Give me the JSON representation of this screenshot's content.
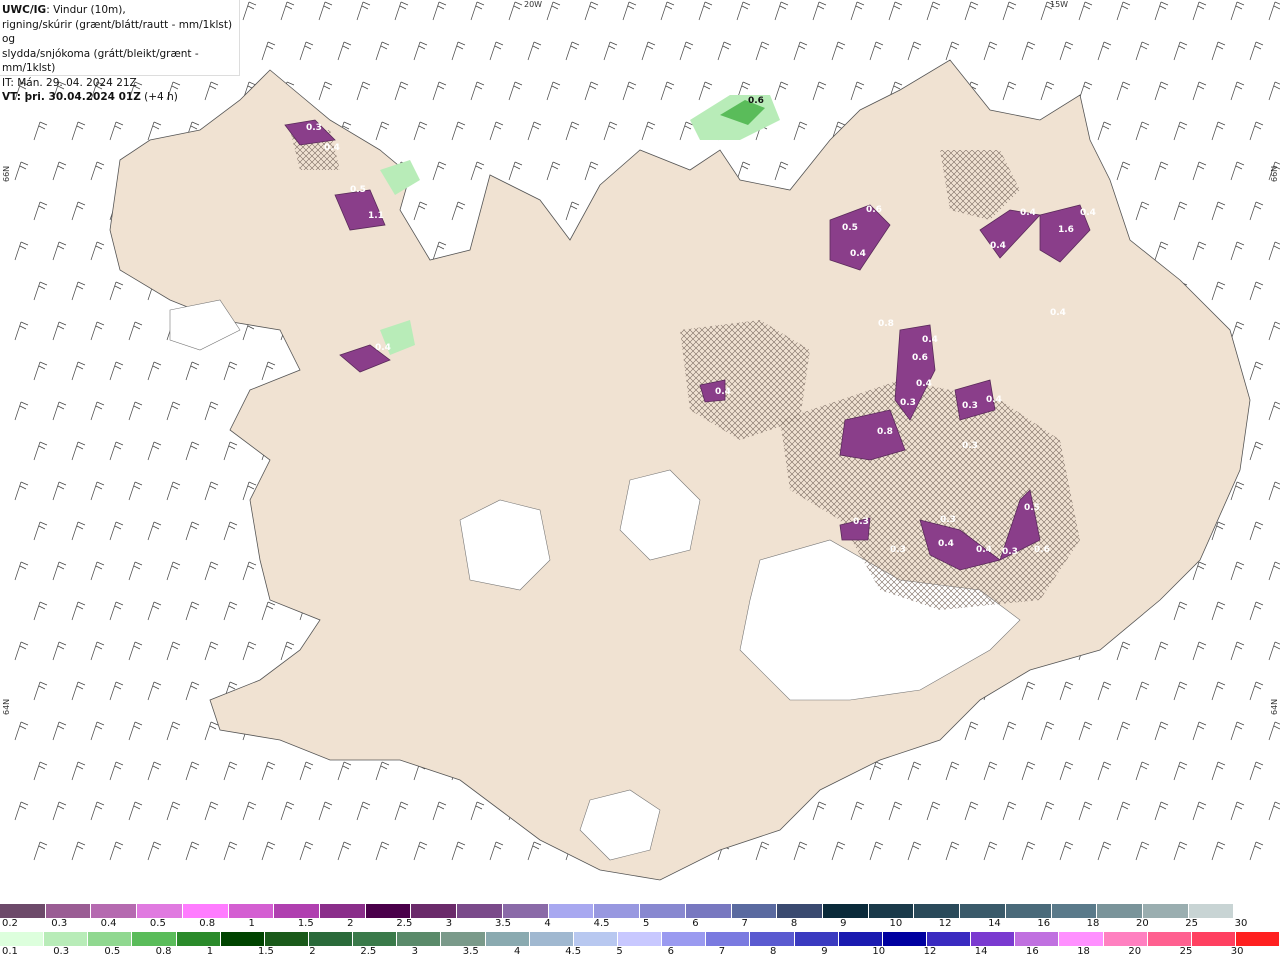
{
  "header": {
    "product": "UWC/IG",
    "description_1": ": Vindur (10m),",
    "description_2": "rigning/skúrir (grænt/blátt/rautt - mm/1klst) og",
    "description_3": "slydda/snjókoma (grátt/bleikt/grænt - mm/1klst)",
    "init_time": "IT: Mán. 29. 04. 2024 21Z",
    "valid_time_label": "VT: þri. 30.04.2024 01Z",
    "valid_offset": " (+4 h)"
  },
  "graticule": {
    "lon_left": "20W",
    "lon_right": "15W",
    "lat_top_left": "66N",
    "lat_top_right": "66N",
    "lat_bottom_left": "64N",
    "lat_bottom_right": "64N"
  },
  "precip_labels": [
    "0.3",
    "0.4",
    "0.5",
    "1.1",
    "0.4",
    "0.6",
    "0.6",
    "0.5",
    "0.4",
    "0.8",
    "0.4",
    "0.6",
    "0.4",
    "1.6",
    "0.4",
    "0.4",
    "0.4",
    "0.4",
    "0.3",
    "0.3",
    "0.4",
    "0.8",
    "0.3",
    "0.3",
    "0.3",
    "0.4",
    "0.3",
    "0.5",
    "0.6",
    "0.4",
    "0.4",
    "0.3"
  ],
  "scale_snow": {
    "colors": [
      "#6d4a6a",
      "#9a5d94",
      "#b56ab0",
      "#e07ae0",
      "#ff7cff",
      "#d45fd2",
      "#b040b0",
      "#8a2e8a",
      "#4a004a",
      "#6a2a6a",
      "#7a4a8a",
      "#8a6aa8",
      "#a8a8f0",
      "#9898e0",
      "#8888d0",
      "#7878c0",
      "#5a6aa0",
      "#3a4a70",
      "#0a2a3a",
      "#1a3a4a",
      "#2a4a5a",
      "#3a5a6a",
      "#4a6a7a",
      "#5a7a8a",
      "#7a949a",
      "#9aaeb0",
      "#c8d4d4",
      "#ffffff"
    ],
    "labels": [
      "0.2",
      "0.3",
      "0.4",
      "0.5",
      "0.8",
      "1",
      "1.5",
      "2",
      "2.5",
      "3",
      "3.5",
      "4",
      "4.5",
      "5",
      "6",
      "7",
      "8",
      "9",
      "10",
      "12",
      "14",
      "16",
      "18",
      "20",
      "25",
      "30"
    ]
  },
  "scale_rain": {
    "colors": [
      "#ddffdd",
      "#b8ecb8",
      "#90d890",
      "#5abc5a",
      "#2a8a2a",
      "#004400",
      "#1a5a1a",
      "#2a6a3a",
      "#3a7a4a",
      "#5a8a6a",
      "#7a9a8a",
      "#8aaab0",
      "#a0b8d0",
      "#b8c8f0",
      "#c8c8ff",
      "#9a9af0",
      "#7a7ae0",
      "#5a5ad0",
      "#3a3ac0",
      "#1a1ab0",
      "#0000a0",
      "#3a2ac0",
      "#7a3ad0",
      "#c070e0",
      "#ff90ff",
      "#ff80c0",
      "#ff6090",
      "#ff4060",
      "#ff2020"
    ],
    "labels": [
      "0.1",
      "0.3",
      "0.5",
      "0.8",
      "1",
      "1.5",
      "2",
      "2.5",
      "3",
      "3.5",
      "4",
      "4.5",
      "5",
      "6",
      "7",
      "8",
      "9",
      "10",
      "12",
      "14",
      "16",
      "18",
      "20",
      "25",
      "30"
    ]
  }
}
